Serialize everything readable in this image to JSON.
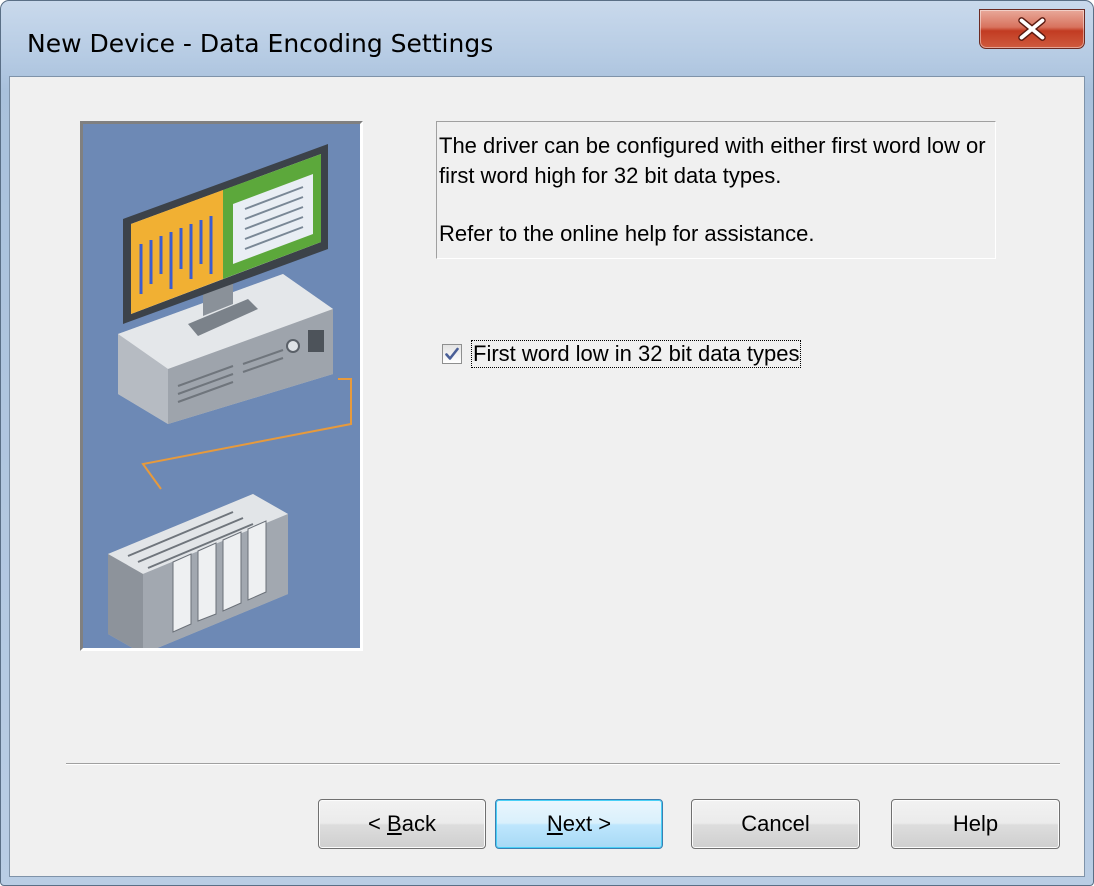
{
  "window": {
    "title": "New Device - Data Encoding Settings"
  },
  "info": {
    "line1": "The driver can be configured with either first word low or first word high for 32 bit data types.",
    "line2": "Refer to the online help for assistance."
  },
  "checkbox": {
    "label": "First word low in 32 bit data types",
    "checked": true
  },
  "buttons": {
    "back": {
      "prefix": "< ",
      "mnemonic": "B",
      "rest": "ack"
    },
    "next": {
      "mnemonic": "N",
      "rest": "ext >"
    },
    "cancel": "Cancel",
    "help": "Help"
  },
  "icons": {
    "close": "close-icon",
    "check": "checkmark-icon",
    "illustration": "computer-plc-illustration"
  },
  "colors": {
    "close_button": "#c23b22",
    "illustration_bg": "#6d89b5",
    "default_button_border": "#3c7fb1"
  }
}
